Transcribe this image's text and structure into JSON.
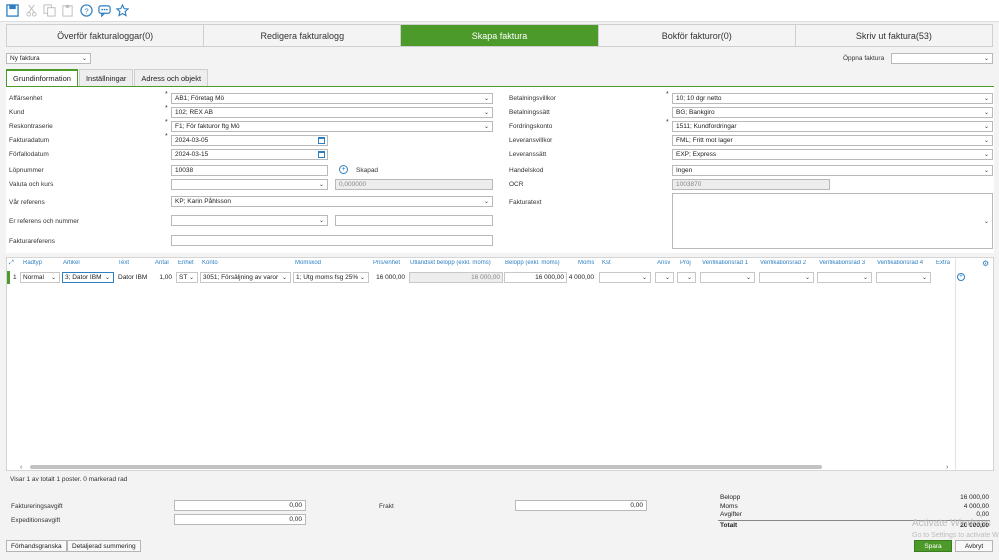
{
  "toolbar_icons": [
    "save-icon",
    "cut-icon",
    "copy-icon",
    "paste-icon",
    "help-icon",
    "chat-icon",
    "star-icon"
  ],
  "main_tabs": [
    {
      "label": "Överför fakturaloggar(0)"
    },
    {
      "label": "Redigera fakturalogg"
    },
    {
      "label": "Skapa faktura",
      "active": true
    },
    {
      "label": "Bokför fakturor(0)"
    },
    {
      "label": "Skriv ut faktura(53)"
    }
  ],
  "invoice_select": "Ny faktura",
  "open_invoice_label": "Öppna faktura",
  "sub_tabs": [
    "Grundinformation",
    "Inställningar",
    "Adress och objekt"
  ],
  "left_fields": {
    "affarsenhet": {
      "label": "Affärsenhet",
      "value": "AB1; Företag Mö"
    },
    "kund": {
      "label": "Kund",
      "value": "102; REX AB"
    },
    "reskontraserie": {
      "label": "Reskontraserie",
      "value": "F1; För fakturor ftg Mö"
    },
    "fakturadatum": {
      "label": "Fakturadatum",
      "value": "2024-03-05"
    },
    "forfallodatum": {
      "label": "Förfallodatum",
      "value": "2024-03-15"
    },
    "lopnummer": {
      "label": "Löpnummer",
      "value": "10038",
      "status": "Skapad"
    },
    "valuta": {
      "label": "Valuta och kurs",
      "value": "",
      "rate": "0,000000"
    },
    "var_referens": {
      "label": "Vår referens",
      "value": "KP; Karin Påhlsson"
    },
    "er_referens": {
      "label": "Er referens och nummer",
      "value": ""
    },
    "fakturareferens": {
      "label": "Fakturareferens",
      "value": ""
    }
  },
  "right_fields": {
    "betalningsvillkor": {
      "label": "Betalningsvillkor",
      "value": "10; 10 dgr netto"
    },
    "betalningssatt": {
      "label": "Betalningssätt",
      "value": "BG; Bankgiro"
    },
    "fordringskonto": {
      "label": "Fordringskonto",
      "value": "1511; Kundfordringar"
    },
    "leveransvillkor": {
      "label": "Leveransvillkor",
      "value": "FML; Fritt mot lager"
    },
    "leveranssatt": {
      "label": "Leveranssätt",
      "value": "EXP; Express"
    },
    "handelskod": {
      "label": "Handelskod",
      "value": "Ingen"
    },
    "ocr": {
      "label": "OCR",
      "value": "1003870"
    },
    "fakturatext": {
      "label": "Fakturatext",
      "value": ""
    }
  },
  "grid": {
    "headers": [
      "Radtyp",
      "Artikel",
      "Text",
      "Antal",
      "Enhet",
      "Konto",
      "Momskod",
      "Pris/enhet",
      "Utländskt belopp (exkl. moms)",
      "Belopp (exkl. moms)",
      "Moms",
      "Kst",
      "Ansv",
      "Proj",
      "Verifikationsrad 1",
      "Verifikationsrad 2",
      "Verifikationsrad 3",
      "Verifikationsrad 4",
      "Extra"
    ],
    "row": {
      "num": "1",
      "radtyp": "Normal",
      "artikel": "3; Dator IBM",
      "text": "Dator IBM",
      "antal": "1,00",
      "enhet": "ST",
      "konto": "3051; Försäljning av varor",
      "momskod": "1; Utg moms fsg 25%",
      "pris": "16 000,00",
      "utl_belopp": "16 000,00",
      "belopp": "16 000,00",
      "moms": "4 000,00"
    },
    "status": "Visar 1 av totalt 1 poster. 0 markerad rad"
  },
  "fees": {
    "faktureringsavgift": {
      "label": "Faktureringsavgift",
      "value": "0,00"
    },
    "expeditionsavgift": {
      "label": "Expeditionsavgift",
      "value": "0,00"
    },
    "frakt": {
      "label": "Frakt",
      "value": "0,00"
    }
  },
  "summary": {
    "belopp": {
      "label": "Belopp",
      "value": "16 000,00"
    },
    "moms": {
      "label": "Moms",
      "value": "4 000,00"
    },
    "avgifter": {
      "label": "Avgifter",
      "value": "0,00"
    },
    "totalt": {
      "label": "Totalt",
      "value": "20 000,00"
    }
  },
  "watermark": {
    "line1": "Activate Windows",
    "line2": "Go to Settings to activate Windows."
  },
  "buttons": {
    "preview": "Förhandsgranska",
    "detailed": "Detaljerad summering",
    "save": "Spara",
    "cancel": "Avbryt"
  },
  "colors": {
    "accent": "#4c9a2a",
    "link": "#2e7fc1"
  }
}
